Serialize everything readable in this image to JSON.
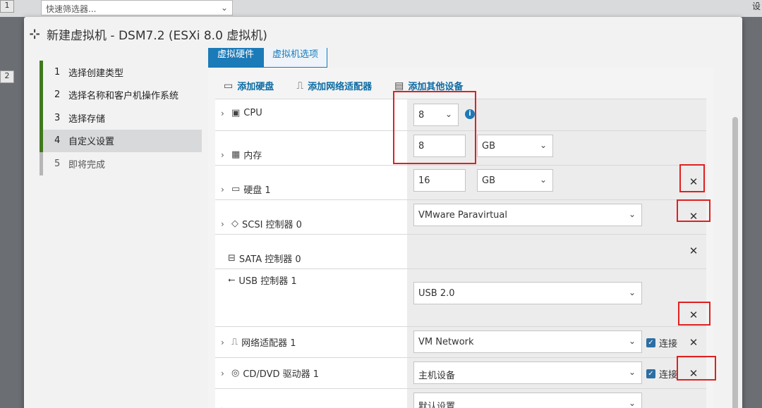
{
  "bg": {
    "filter_placeholder": "快速筛选器...",
    "num1": "1",
    "num2": "2",
    "right_text": "设"
  },
  "dialog": {
    "title": "新建虚拟机 - DSM7.2 (ESXi 8.0 虚拟机)"
  },
  "steps": [
    {
      "n": "1",
      "label": "选择创建类型"
    },
    {
      "n": "2",
      "label": "选择名称和客户机操作系统"
    },
    {
      "n": "3",
      "label": "选择存储"
    },
    {
      "n": "4",
      "label": "自定义设置"
    },
    {
      "n": "5",
      "label": "即将完成"
    }
  ],
  "tabs": [
    {
      "label": "虚拟硬件"
    },
    {
      "label": "虚拟机选项"
    }
  ],
  "toolbar": {
    "add_disk": "添加硬盘",
    "add_nic": "添加网络适配器",
    "add_other": "添加其他设备"
  },
  "hw": {
    "cpu": {
      "label": "CPU",
      "value": "8"
    },
    "mem": {
      "label": "内存",
      "value": "8",
      "unit": "GB"
    },
    "disk": {
      "label": "硬盘 1",
      "value": "16",
      "unit": "GB"
    },
    "scsi": {
      "label": "SCSI 控制器 0",
      "value": "VMware Paravirtual"
    },
    "sata": {
      "label": "SATA 控制器 0"
    },
    "usb": {
      "label": "USB 控制器 1",
      "value": "USB 2.0"
    },
    "nic": {
      "label": "网络适配器 1",
      "value": "VM Network",
      "connect": "连接"
    },
    "cd": {
      "label": "CD/DVD 驱动器 1",
      "value": "主机设备",
      "connect": "连接"
    },
    "last": {
      "value": "默认设置"
    }
  }
}
